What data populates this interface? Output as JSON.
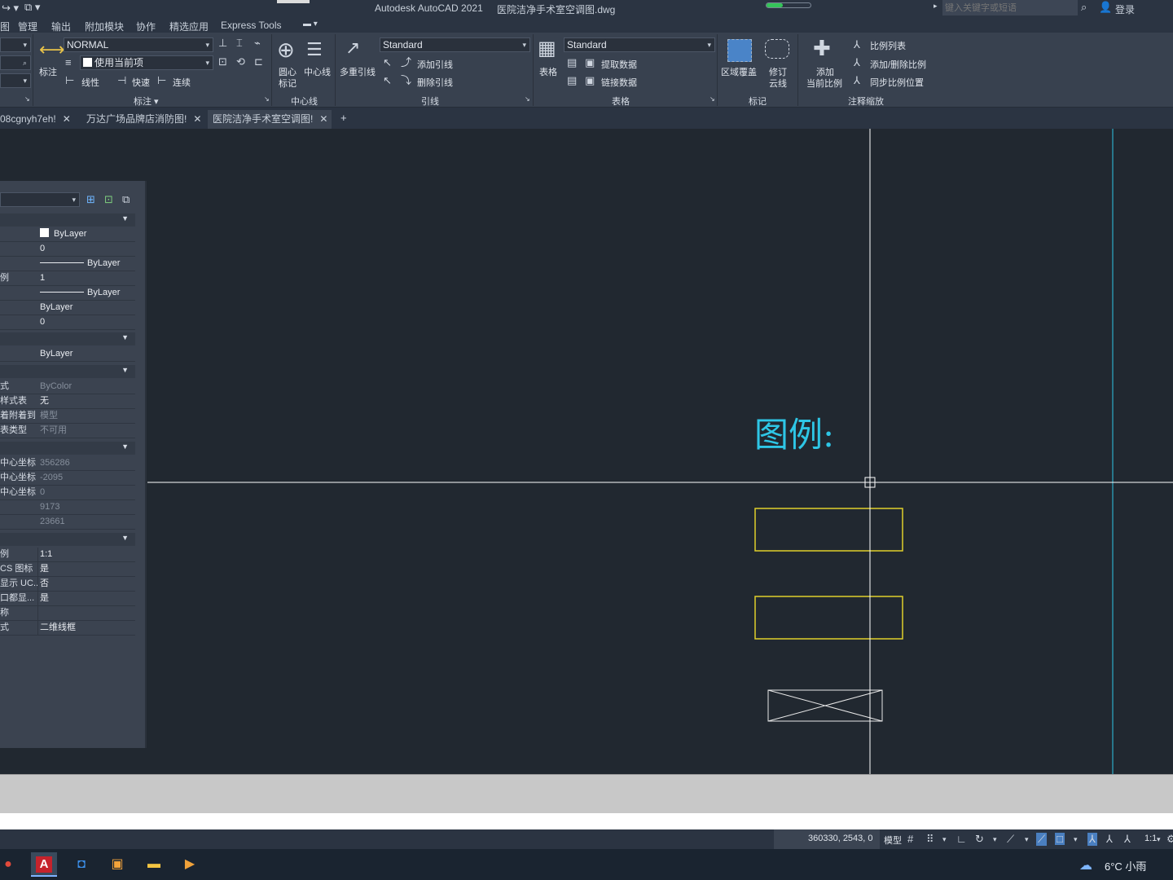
{
  "window": {
    "title": "Autodesk AutoCAD 2021",
    "filename": "医院洁净手术室空调图.dwg",
    "search_placeholder": "键入关键字或短语",
    "login": "登录"
  },
  "menu": [
    "图",
    "管理",
    "输出",
    "附加模块",
    "协作",
    "精选应用",
    "Express Tools"
  ],
  "ribbon": {
    "annotation": {
      "text_style": "NORMAL",
      "layer_combo": "使用当前项",
      "big_button": "标注",
      "linear": "线性",
      "quick": "快速",
      "continue": "连续",
      "panel_label": "标注 ▾"
    },
    "centerline": {
      "center_mark": [
        "圆心",
        "标记"
      ],
      "centerline": "中心线",
      "panel_label": "中心线"
    },
    "leader": {
      "mleader": "多重引线",
      "style": "Standard",
      "add": "添加引线",
      "remove": "删除引线",
      "panel_label": "引线"
    },
    "table": {
      "big_button": "表格",
      "style": "Standard",
      "extract": "提取数据",
      "link": "链接数据",
      "panel_label": "表格"
    },
    "markup": {
      "wipeout": "区域覆盖",
      "revcloud": [
        "修订",
        "云线"
      ],
      "panel_label": "标记"
    },
    "scale": {
      "add_current": [
        "添加",
        "当前比例"
      ],
      "scale_list": "比例列表",
      "add_delete": "添加/删除比例",
      "sync": "同步比例位置",
      "panel_label": "注释缩放"
    }
  },
  "tabs": [
    {
      "label": "08cgnyh7eh!",
      "active": false
    },
    {
      "label": "万达广场品牌店消防图!",
      "active": false
    },
    {
      "label": "医院洁净手术室空调图!",
      "active": true
    }
  ],
  "properties": {
    "general": [
      {
        "key": "",
        "value": "ByLayer",
        "swatch": true
      },
      {
        "key": "",
        "value": "0"
      },
      {
        "key": "",
        "value": "ByLayer",
        "line": true
      },
      {
        "key": "例",
        "value": "1"
      },
      {
        "key": "",
        "value": "ByLayer",
        "line": true
      },
      {
        "key": "",
        "value": "ByLayer"
      },
      {
        "key": "",
        "value": "0"
      }
    ],
    "view3d": [
      {
        "key": "",
        "value": "ByLayer"
      }
    ],
    "plot": [
      {
        "key": "式",
        "value": "ByColor",
        "dim": true
      },
      {
        "key": "样式表",
        "value": "无"
      },
      {
        "key": "着附着到",
        "value": "模型",
        "dim": true
      },
      {
        "key": "表类型",
        "value": "不可用",
        "dim": true
      }
    ],
    "view": [
      {
        "key": "中心坐标",
        "value": "356286",
        "dim": true
      },
      {
        "key": "中心坐标",
        "value": "-2095",
        "dim": true
      },
      {
        "key": "中心坐标",
        "value": "0",
        "dim": true
      },
      {
        "key": "",
        "value": "9173",
        "dim": true
      },
      {
        "key": "",
        "value": "23661",
        "dim": true
      }
    ],
    "misc": [
      {
        "key": "例",
        "value": "1:1"
      },
      {
        "key": "CS 图标",
        "value": "是"
      },
      {
        "key": "显示 UC...",
        "value": "否"
      },
      {
        "key": "口都显...",
        "value": "是"
      },
      {
        "key": "称",
        "value": ""
      },
      {
        "key": "式",
        "value": "二维线框"
      }
    ]
  },
  "drawing": {
    "legend_text": "图例:"
  },
  "status": {
    "coords": "360330, 2543, 0",
    "model": "模型",
    "scale": "1:1"
  },
  "taskbar": {
    "weather": "6°C  小雨"
  },
  "colors": {
    "canvas": "#212830",
    "cyan": "#2ec6e6",
    "yellow": "#e0cf2a",
    "crosshair": "#ffffff"
  }
}
